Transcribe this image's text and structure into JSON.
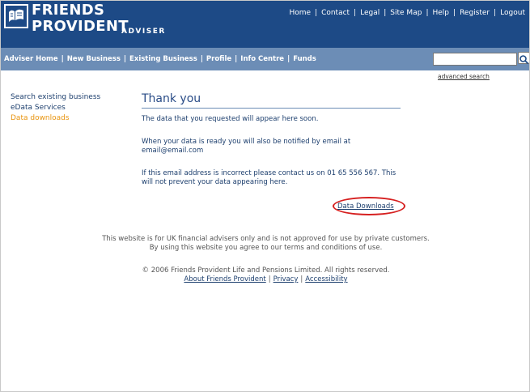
{
  "brand": {
    "line1": "FRIENDS",
    "line2": "PROVIDENT",
    "sub": "ADVISER"
  },
  "top_links": [
    "Home",
    "Contact",
    "Legal",
    "Site Map",
    "Help",
    "Register",
    "Logout"
  ],
  "nav_items": [
    "Adviser Home",
    "New Business",
    "Existing Business",
    "Profile",
    "Info Centre",
    "Funds"
  ],
  "search": {
    "value": "",
    "advanced_label": "advanced search"
  },
  "sidebar": {
    "items": [
      {
        "label": "Search existing business",
        "active": false
      },
      {
        "label": "eData Services",
        "active": false
      },
      {
        "label": "Data downloads",
        "active": true
      }
    ]
  },
  "content": {
    "title": "Thank you",
    "p1": "The data that you requested will appear here soon.",
    "p2": "When your data is ready you will also be notified by email at email@email.com",
    "p3": "If this email address is incorrect please contact us on 01 65 556 567. This will not prevent your data appearing here.",
    "download_link": "Data Downloads"
  },
  "footer": {
    "note_line1": "This website is for UK financial advisers only and is not approved for use by private customers.",
    "note_line2": "By using this website you agree to our terms and conditions of use.",
    "copyright": "© 2006 Friends Provident Life and Pensions Limited. All rights reserved.",
    "links": [
      "About Friends Provident",
      "Privacy",
      "Accessibility"
    ]
  },
  "colors": {
    "header_blue": "#1d4a86",
    "nav_blue": "#6c8db6",
    "link_navy": "#1d3f6e",
    "active_orange": "#e8940f",
    "highlight_red": "#d62020"
  }
}
